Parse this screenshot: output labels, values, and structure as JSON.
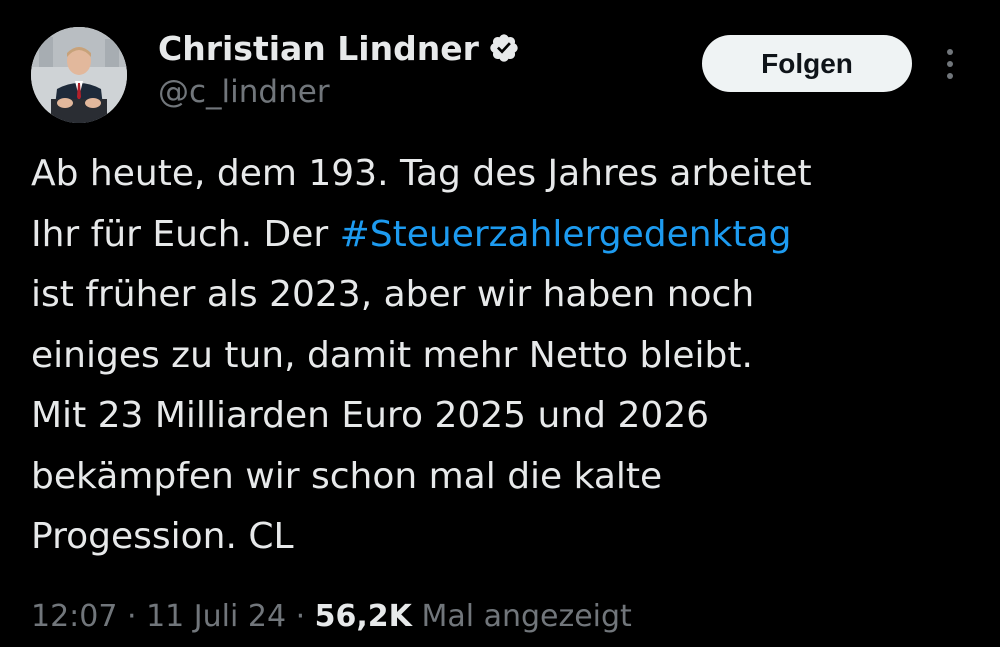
{
  "author": {
    "display_name": "Christian Lindner",
    "handle": "@c_lindner",
    "verified_icon": "verified-badge-icon"
  },
  "follow_button": {
    "label": "Folgen"
  },
  "more_menu": {
    "icon": "more-vertical-icon"
  },
  "tweet": {
    "text_part1": "Ab heute, dem 193. Tag des Jahres arbeitet\nIhr für Euch. Der ",
    "hashtag": "#Steuerzahlergedenktag",
    "text_part2": "\nist früher als 2023, aber wir haben noch\neiniges zu tun, damit mehr Netto bleibt.\nMit 23 Milliarden Euro 2025 und 2026\nbekämpfen wir schon mal die kalte\nProgession. CL"
  },
  "meta": {
    "time": "12:07",
    "separator": " · ",
    "date": "11 Juli 24",
    "views_count": "56,2K",
    "views_label": " Mal angezeigt"
  },
  "colors": {
    "background": "#000000",
    "text_primary": "#e7e9ea",
    "text_secondary": "#71767b",
    "link": "#1d9bf0",
    "follow_bg": "#eff3f4",
    "verified_badge": "#e7e9ea"
  }
}
